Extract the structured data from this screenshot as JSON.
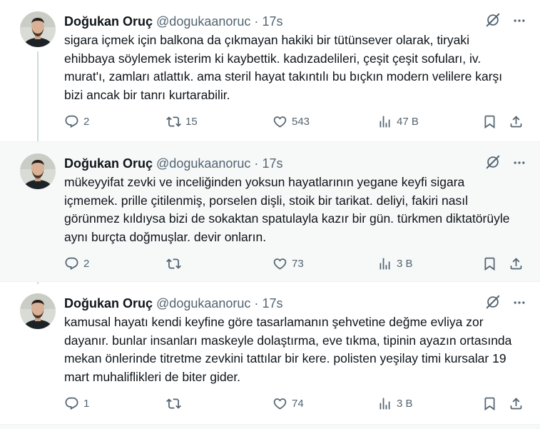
{
  "tweets": [
    {
      "name": "Doğukan Oruç",
      "handle": "@dogukaanoruc",
      "dot": "·",
      "time": "17s",
      "text": "sigara içmek için balkona da çıkmayan hakiki bir tütünsever olarak, tiryaki ehibbaya söylemek isterim ki kaybettik. kadızadelileri, çeşit çeşit sofuları, iv. murat'ı, zamları atlattık. ama steril hayat takıntılı bu bıçkın modern velilere karşı bizi ancak bir tanrı kurtarabilir.",
      "replies": "2",
      "retweets": "15",
      "likes": "543",
      "views": "47 B"
    },
    {
      "name": "Doğukan Oruç",
      "handle": "@dogukaanoruc",
      "dot": "·",
      "time": "17s",
      "text": "mükeyyifat zevki ve inceliğinden yoksun hayatlarının yegane keyfi sigara içmemek. prille çitilenmiş, porselen dişli, stoik bir tarikat. deliyi, fakiri nasıl görünmez kıldıysa bizi de sokaktan spatulayla kazır bir gün. türkmen diktatörüyle aynı burçta doğmuşlar. devir onların.",
      "replies": "2",
      "retweets": "",
      "likes": "73",
      "views": "3 B"
    },
    {
      "name": "Doğukan Oruç",
      "handle": "@dogukaanoruc",
      "dot": "·",
      "time": "17s",
      "text": "kamusal hayatı kendi keyfine göre tasarlamanın şehvetine değme evliya zor dayanır. bunlar insanları maskeyle dolaştırma, eve tıkma, tipinin ayazın ortasında mekan önlerinde titretme zevkini tattılar bir kere. polisten yeşilay timi kursalar 19 mart muhaliflikleri de biter gider.",
      "replies": "1",
      "retweets": "",
      "likes": "74",
      "views": "3 B"
    }
  ],
  "icons": [
    "avatar",
    "grok-icon",
    "more-icon",
    "reply-icon",
    "retweet-icon",
    "like-icon",
    "views-icon",
    "bookmark-icon",
    "share-icon"
  ]
}
